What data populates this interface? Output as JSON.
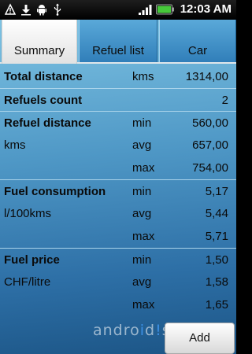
{
  "status_bar": {
    "icons": [
      "warning-icon",
      "download-icon",
      "android-icon",
      "usb-icon",
      "signal-icon",
      "battery-icon"
    ],
    "time": "12:03 AM"
  },
  "tabs": [
    {
      "label": "Summary",
      "active": true
    },
    {
      "label": "Refuel list",
      "active": false
    },
    {
      "label": "Car",
      "active": false
    }
  ],
  "summary": {
    "total_distance": {
      "label": "Total distance",
      "unit": "kms",
      "value": "1314,00"
    },
    "refuels_count": {
      "label": "Refuels count",
      "value": "2"
    },
    "refuel_distance": {
      "label": "Refuel distance",
      "unit": "kms",
      "min_label": "min",
      "min": "560,00",
      "avg_label": "avg",
      "avg": "657,00",
      "max_label": "max",
      "max": "754,00"
    },
    "fuel_consumption": {
      "label": "Fuel consumption",
      "unit": "l/100kms",
      "min_label": "min",
      "min": "5,17",
      "avg_label": "avg",
      "avg": "5,44",
      "max_label": "max",
      "max": "5,71"
    },
    "fuel_price": {
      "label": "Fuel price",
      "unit": "CHF/litre",
      "min_label": "min",
      "min": "1,50",
      "avg_label": "avg",
      "avg": "1,58",
      "max_label": "max",
      "max": "1,65"
    }
  },
  "add_button": "Add",
  "watermark": {
    "part1": "andro",
    "part2": "i",
    "part3": "d",
    "part4": "!",
    "part5": "s"
  }
}
